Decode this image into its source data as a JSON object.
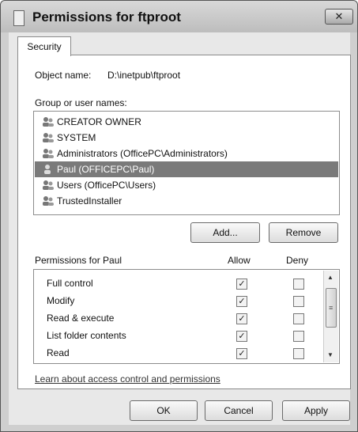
{
  "window": {
    "title": "Permissions for ftproot",
    "close_label": "✕"
  },
  "tab": {
    "label": "Security"
  },
  "object": {
    "label": "Object name:",
    "value": "D:\\inetpub\\ftproot"
  },
  "group": {
    "label": "Group or user names:",
    "items": [
      {
        "label": "CREATOR OWNER",
        "icon": "users-icon"
      },
      {
        "label": "SYSTEM",
        "icon": "users-icon"
      },
      {
        "label": "Administrators (OfficePC\\Administrators)",
        "icon": "users-icon"
      },
      {
        "label": "Paul (OFFICEPC\\Paul)",
        "icon": "user-icon",
        "selected": true
      },
      {
        "label": "Users (OfficePC\\Users)",
        "icon": "users-icon"
      },
      {
        "label": "TrustedInstaller",
        "icon": "users-icon"
      }
    ]
  },
  "buttons": {
    "add": "Add...",
    "remove": "Remove",
    "ok": "OK",
    "cancel": "Cancel",
    "apply": "Apply"
  },
  "permissions": {
    "header": "Permissions for Paul",
    "allow_label": "Allow",
    "deny_label": "Deny",
    "rows": [
      {
        "name": "Full control",
        "allow": true,
        "deny": false
      },
      {
        "name": "Modify",
        "allow": true,
        "deny": false
      },
      {
        "name": "Read & execute",
        "allow": true,
        "deny": false
      },
      {
        "name": "List folder contents",
        "allow": true,
        "deny": false
      },
      {
        "name": "Read",
        "allow": true,
        "deny": false
      }
    ]
  },
  "link": "Learn about access control and permissions"
}
